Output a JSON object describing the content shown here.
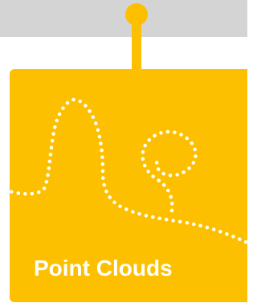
{
  "card": {
    "title": "Point Clouds",
    "icon": "point-cloud-path-icon",
    "colors": {
      "card": "#fdc000",
      "pin": "#fdc000",
      "bar": "#d4d4d4",
      "text": "#ffffff",
      "dots": "#ffffff"
    }
  }
}
